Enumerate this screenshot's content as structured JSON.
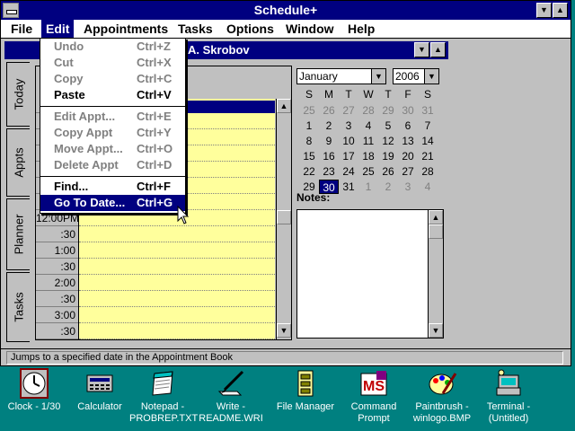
{
  "window": {
    "title": "Schedule+"
  },
  "menubar": [
    "File",
    "Edit",
    "Appointments",
    "Tasks",
    "Options",
    "Window",
    "Help"
  ],
  "child": {
    "title": "A. Skrobov"
  },
  "tabs": [
    "Today",
    "Appts",
    "Planner",
    "Tasks"
  ],
  "time_rows": [
    "",
    "",
    "",
    "",
    "",
    "",
    "",
    "",
    "",
    "",
    "12:00PM",
    ":30",
    "1:00",
    ":30",
    "2:00",
    ":30",
    "3:00",
    ":30"
  ],
  "edit_menu": {
    "items": [
      {
        "label": "Undo",
        "shortcut": "Ctrl+Z",
        "disabled": true
      },
      {
        "label": "Cut",
        "shortcut": "Ctrl+X",
        "disabled": true
      },
      {
        "label": "Copy",
        "shortcut": "Ctrl+C",
        "disabled": true
      },
      {
        "label": "Paste",
        "shortcut": "Ctrl+V",
        "disabled": false
      },
      {
        "label": "Edit Appt...",
        "shortcut": "Ctrl+E",
        "disabled": true
      },
      {
        "label": "Copy Appt",
        "shortcut": "Ctrl+Y",
        "disabled": true
      },
      {
        "label": "Move Appt...",
        "shortcut": "Ctrl+O",
        "disabled": true
      },
      {
        "label": "Delete Appt",
        "shortcut": "Ctrl+D",
        "disabled": true
      },
      {
        "label": "Find...",
        "shortcut": "Ctrl+F",
        "disabled": false
      },
      {
        "label": "Go To Date...",
        "shortcut": "Ctrl+G",
        "disabled": false,
        "highlighted": true
      }
    ]
  },
  "calendar": {
    "month": "January",
    "year": "2006",
    "weekdays": [
      "S",
      "M",
      "T",
      "W",
      "T",
      "F",
      "S"
    ],
    "weeks": [
      [
        "25",
        "26",
        "27",
        "28",
        "29",
        "30",
        "31"
      ],
      [
        "1",
        "2",
        "3",
        "4",
        "5",
        "6",
        "7"
      ],
      [
        "8",
        "9",
        "10",
        "11",
        "12",
        "13",
        "14"
      ],
      [
        "15",
        "16",
        "17",
        "18",
        "19",
        "20",
        "21"
      ],
      [
        "22",
        "23",
        "24",
        "25",
        "26",
        "27",
        "28"
      ],
      [
        "29",
        "30",
        "31",
        "1",
        "2",
        "3",
        "4"
      ]
    ],
    "selected": "30"
  },
  "notes_label": "Notes:",
  "status": "Jumps to a specified date in the Appointment Book",
  "desktop_icons": [
    {
      "name": "clock",
      "label": "Clock - 1/30"
    },
    {
      "name": "calculator",
      "label": "Calculator"
    },
    {
      "name": "notepad",
      "label": "Notepad -\nPROBREP.TXT"
    },
    {
      "name": "write",
      "label": "Write -\nREADME.WRI"
    },
    {
      "name": "file-manager",
      "label": "File Manager"
    },
    {
      "name": "command-prompt",
      "label": "Command\nPrompt"
    },
    {
      "name": "paintbrush",
      "label": "Paintbrush -\nwinlogo.BMP"
    },
    {
      "name": "terminal",
      "label": "Terminal -\n(Untitled)"
    }
  ],
  "colors": {
    "desktop": "#008080",
    "titlebar": "#000080",
    "appointment_bg": "#ffff9c",
    "face": "#c0c0c0"
  }
}
